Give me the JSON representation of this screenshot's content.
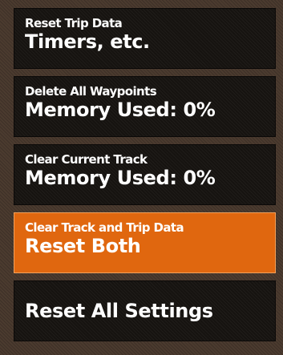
{
  "menu": {
    "items": [
      {
        "label": "Reset Trip Data",
        "value": "Timers, etc."
      },
      {
        "label": "Delete All Waypoints",
        "value": "Memory Used: 0%"
      },
      {
        "label": "Clear Current Track",
        "value": "Memory Used: 0%"
      },
      {
        "label": "Clear Track and Trip Data",
        "value": "Reset Both",
        "selected": true
      },
      {
        "label": "",
        "value": "Reset All Settings"
      }
    ]
  },
  "colors": {
    "background": "#4b3b2f",
    "item_background": "#161310",
    "selected_background": "#e0670f",
    "text": "#ffffff"
  }
}
